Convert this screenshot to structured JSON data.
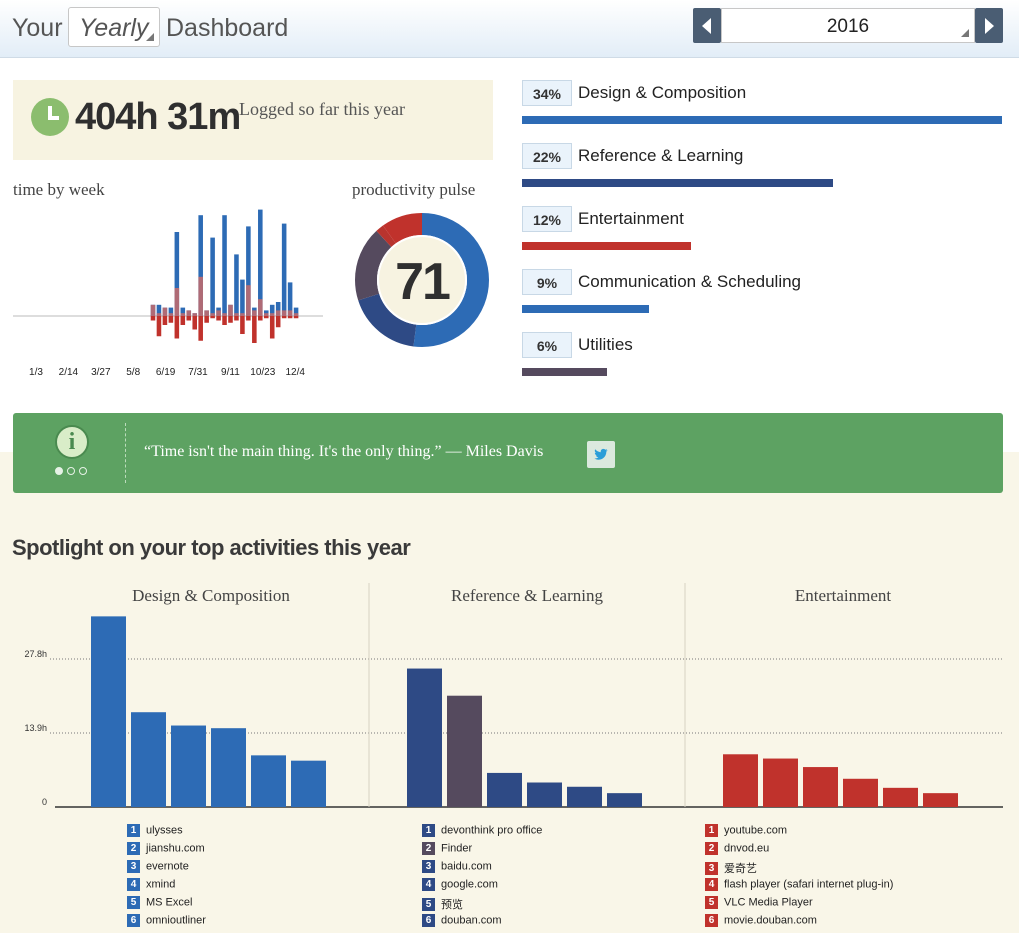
{
  "header": {
    "prefix": "Your",
    "period": "Yearly",
    "suffix": "Dashboard",
    "year": "2016"
  },
  "summary": {
    "total": "404h 31m",
    "caption": "Logged so far this year"
  },
  "week_chart": {
    "title": "time by week",
    "tick_labels": [
      "1/3",
      "2/14",
      "3/27",
      "5/8",
      "6/19",
      "7/31",
      "9/11",
      "10/23",
      "12/4"
    ],
    "productive": [
      0,
      0,
      0,
      0,
      0,
      0,
      0,
      0,
      0,
      0,
      0,
      0,
      0,
      0,
      0,
      0,
      0,
      0,
      0,
      0,
      0,
      0,
      0,
      4,
      1,
      3,
      1,
      10,
      1,
      2,
      1,
      14,
      2,
      1,
      2,
      1,
      4,
      1,
      1,
      11,
      2,
      6,
      1,
      1,
      2,
      2,
      2,
      1,
      0,
      0,
      0,
      0
    ],
    "productive_total": [
      0,
      0,
      0,
      0,
      0,
      0,
      0,
      0,
      0,
      0,
      0,
      0,
      0,
      0,
      0,
      0,
      0,
      0,
      0,
      0,
      0,
      0,
      0,
      4,
      4,
      3,
      3,
      30,
      3,
      2,
      1,
      36,
      2,
      28,
      3,
      36,
      4,
      22,
      13,
      32,
      3,
      38,
      2,
      4,
      5,
      33,
      12,
      3,
      0,
      0,
      0,
      0
    ],
    "distracting": [
      0,
      0,
      0,
      0,
      0,
      0,
      0,
      0,
      0,
      0,
      0,
      0,
      0,
      0,
      0,
      0,
      0,
      0,
      0,
      0,
      0,
      0,
      0,
      2,
      9,
      4,
      3,
      10,
      4,
      2,
      6,
      11,
      3,
      1,
      2,
      4,
      3,
      2,
      8,
      2,
      12,
      2,
      1,
      10,
      5,
      1,
      1,
      1,
      0,
      0,
      0,
      0
    ],
    "max": 40
  },
  "pulse": {
    "title": "productivity pulse",
    "value": "71",
    "segments": [
      {
        "fraction": 0.52,
        "color": "#2d6bb5"
      },
      {
        "fraction": 0.18,
        "color": "#2e4a85"
      },
      {
        "fraction": 0.18,
        "color": "#554a5e"
      },
      {
        "fraction": 0.02,
        "color": "#b8342e"
      },
      {
        "fraction": 0.1,
        "color": "#c0322c"
      }
    ]
  },
  "categories": [
    {
      "pct": "34%",
      "name": "Design & Composition",
      "share": 34,
      "color": "#2d6bb5"
    },
    {
      "pct": "22%",
      "name": "Reference & Learning",
      "share": 22,
      "color": "#2e4a85"
    },
    {
      "pct": "12%",
      "name": "Entertainment",
      "share": 12,
      "color": "#c0322c"
    },
    {
      "pct": "9%",
      "name": "Communication & Scheduling",
      "share": 9,
      "color": "#2d6bb5"
    },
    {
      "pct": "6%",
      "name": "Utilities",
      "share": 6,
      "color": "#554a5e"
    }
  ],
  "quote": {
    "text": "“Time isn't the main thing. It's the only thing.” — Miles Davis",
    "info_glyph": "i",
    "share_icon": "twitter-icon"
  },
  "spotlight": {
    "title": "Spotlight on your top activities this year"
  },
  "chart_data": {
    "type": "bar",
    "ylim": [
      0,
      40
    ],
    "y_ticks": [
      0,
      13.9,
      27.8
    ],
    "y_tick_labels": [
      "0",
      "13.9h",
      "27.8h"
    ],
    "groups": [
      {
        "title": "Design & Composition",
        "apps": [
          "ulysses",
          "jianshu.com",
          "evernote",
          "xmind",
          "MS Excel",
          "omnioutliner"
        ],
        "values": [
          35.8,
          17.8,
          15.3,
          14.8,
          9.7,
          8.7
        ],
        "colors": [
          "#2d6bb5",
          "#2d6bb5",
          "#2d6bb5",
          "#2d6bb5",
          "#2d6bb5",
          "#2d6bb5"
        ]
      },
      {
        "title": "Reference & Learning",
        "apps": [
          "devonthink pro office",
          "Finder",
          "baidu.com",
          "google.com",
          "预览",
          "douban.com"
        ],
        "values": [
          26.0,
          20.9,
          6.4,
          4.6,
          3.8,
          2.6
        ],
        "colors": [
          "#2e4a85",
          "#554a5e",
          "#2e4a85",
          "#2e4a85",
          "#2e4a85",
          "#2e4a85"
        ]
      },
      {
        "title": "Entertainment",
        "apps": [
          "youtube.com",
          "dnvod.eu",
          "爱奇艺",
          "flash player (safari internet plug-in)",
          "VLC Media Player",
          "movie.douban.com"
        ],
        "values": [
          9.9,
          9.1,
          7.5,
          5.3,
          3.6,
          2.6
        ],
        "colors": [
          "#c0322c",
          "#c0322c",
          "#c0322c",
          "#c0322c",
          "#c0322c",
          "#c0322c"
        ]
      }
    ]
  }
}
